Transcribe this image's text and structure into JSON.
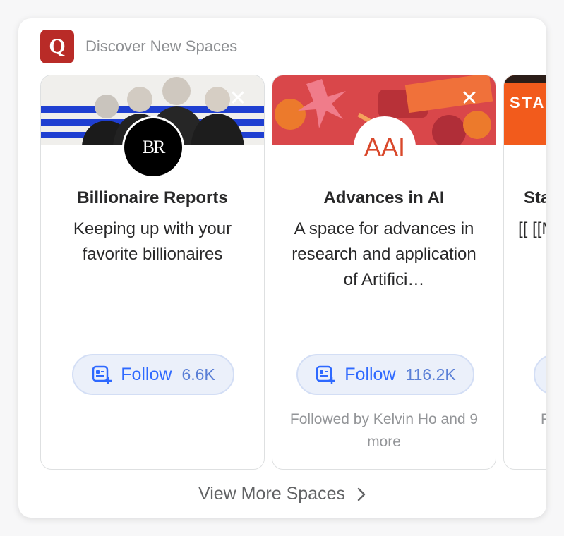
{
  "header": {
    "logo_letter": "Q",
    "title": "Discover New Spaces"
  },
  "cards": [
    {
      "title": "Billionaire Reports",
      "description": "Keeping up with your favorite billionaires",
      "avatar_text": "BR",
      "follow_label": "Follow",
      "follow_count": "6.6K",
      "followed_by": ""
    },
    {
      "title": "Advances in AI",
      "description": "A space for advances in research and application of Artifici…",
      "avatar_text": "AAI",
      "follow_label": "Follow",
      "follow_count": "116.2K",
      "followed_by": "Followed by Kelvin Ho and 9 more"
    },
    {
      "title": "Sta",
      "description": "[[ [[M",
      "banner_text": "STA",
      "followed_by": "F"
    }
  ],
  "footer": {
    "view_more_label": "View More Spaces"
  },
  "icons": {
    "close": "close-icon",
    "follow": "add-space-icon",
    "chevron": "chevron-right-icon"
  },
  "colors": {
    "brand": "#b92b27",
    "accent": "#2e69ff"
  }
}
